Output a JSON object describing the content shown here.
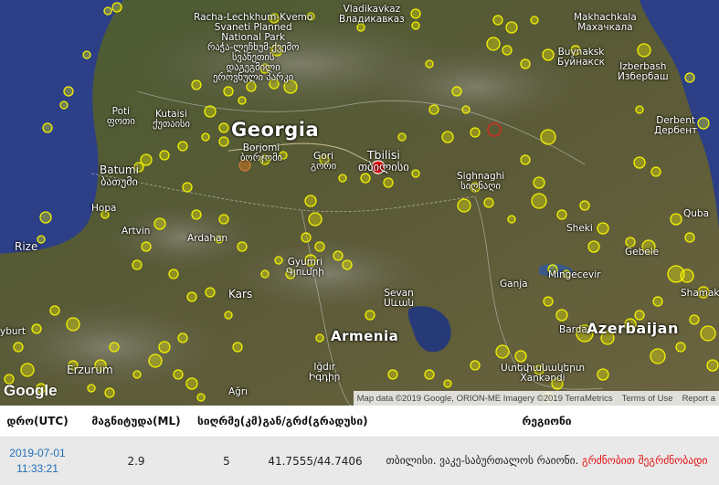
{
  "map": {
    "places": {
      "georgia": "Georgia",
      "armenia": "Armenia",
      "azerbaijan": "Azerbaijan",
      "tbilisi": "Tbilisi",
      "tbilisi_ka": "თბილისი",
      "kutaisi": "Kutaisi",
      "kutaisi_ka": "ქუთაისი",
      "batumi": "Batumi",
      "batumi_ka": "ბათუმი",
      "poti": "Poti",
      "poti_ka": "ფოთი",
      "borjomi": "Borjomi",
      "borjomi_ka": "ბორჯომი",
      "gori": "Gori",
      "gori_ka": "გორი",
      "sighnaghi": "Sighnaghi",
      "sighnaghi_ka": "სიღნაღი",
      "vladikavkaz": "Vladikavkaz",
      "vladikavkaz_ru": "Владикавказ",
      "makhachkala": "Makhachkala",
      "makhachkala_ru": "Махачкала",
      "buynaksk": "Buynaksk",
      "buynaksk_ru": "Буйнакск",
      "izberbash": "Izberbash",
      "izberbash_ru": "Избербаш",
      "derbent": "Derbent",
      "derbent_ru": "Дербент",
      "park_1": "Racha-Lechkhum-Kvemo",
      "park_2": "Svaneti Planned",
      "park_3": "National Park",
      "park_ka_1": "რაჭა-ლეჩხუმ-ქვემო",
      "park_ka_2": "სვანეთის",
      "park_ka_3": "დაგეგმილი",
      "park_ka_4": "ეროვნული პარკი",
      "sheki": "Sheki",
      "gebele": "Gebele",
      "quba": "Quba",
      "mingecevir": "Mingecevir",
      "ganja": "Ganja",
      "barda": "Barda",
      "shamakhi": "Shamakhi",
      "xankendi": "Xankəndi",
      "xankendi_hy": "Ստեփանակերտ",
      "sevan": "Sevan",
      "sevan_hy": "Սևան",
      "gyumri": "Gyumri",
      "gyumri_hy": "Գյումրի",
      "igdir": "Iğdır",
      "igdir_hy": "Իգդիր",
      "artvin": "Artvin",
      "ardahan": "Ardahan",
      "hopa": "Hopa",
      "rize": "Rize",
      "kars": "Kars",
      "erzurum": "Erzurum",
      "agri": "Ağrı",
      "bayburt_partial": "yburt"
    },
    "google_logo": "Google",
    "attribution": {
      "data": "Map data ©2019 Google, ORION-ME Imagery ©2019 TerraMetrics",
      "terms": "Terms of Use",
      "report": "Report a"
    },
    "colors": {
      "event_marker": "#ff0000",
      "past_events": "#f2f200",
      "sea": "#2b3f86",
      "land": "#4a5a34"
    }
  },
  "table": {
    "headers": [
      "დრო(UTC)",
      "მაგნიტუდა(ML)",
      "სიღრმე(კმ)",
      "გან/გრძ(გრადუსი)",
      "რეგიონი"
    ],
    "row": {
      "date": "2019-07-01",
      "time": "11:33:21",
      "magnitude": "2.9",
      "depth": "5",
      "coords": "41.7555/44.7406",
      "region": "თბილისი. ვაკე-საბურთალოს რაიონი.",
      "felt": "გრძნობით შეგრძნობადი"
    }
  }
}
